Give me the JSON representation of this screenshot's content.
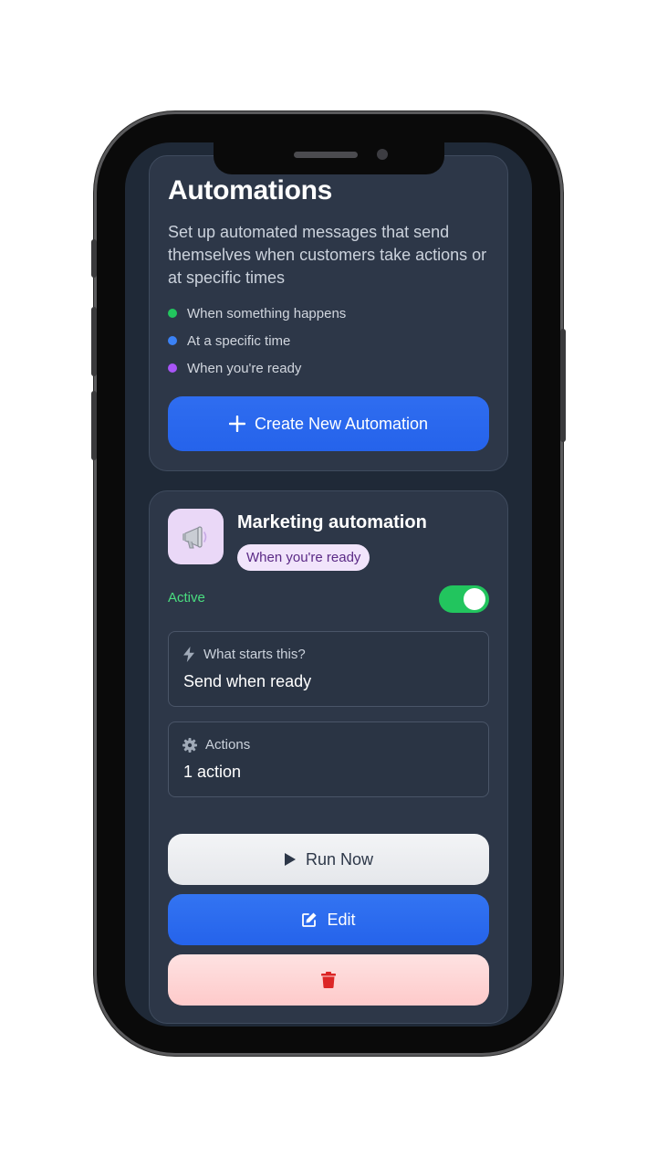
{
  "header": {
    "title": "Automations",
    "description": "Set up automated messages that send themselves when customers take actions or at specific times"
  },
  "triggers": [
    {
      "label": "When something happens",
      "color": "#22c55e"
    },
    {
      "label": "At a specific time",
      "color": "#3b82f6"
    },
    {
      "label": "When you're ready",
      "color": "#a855f7"
    }
  ],
  "create_button": {
    "label": "Create New Automation",
    "icon": "plus-icon"
  },
  "automation": {
    "icon": "megaphone-icon",
    "name": "Marketing automation",
    "trigger_badge": "When you're ready",
    "status": "Active",
    "enabled": true,
    "trigger_box": {
      "icon": "lightning-icon",
      "label": "What starts this?",
      "value": "Send when ready"
    },
    "actions_box": {
      "icon": "gear-icon",
      "label": "Actions",
      "value": "1 action"
    },
    "run_button": {
      "label": "Run Now",
      "icon": "play-icon"
    },
    "edit_button": {
      "label": "Edit",
      "icon": "edit-icon"
    },
    "delete_button": {
      "icon": "trash-icon"
    }
  },
  "colors": {
    "accent": "#2563eb",
    "active": "#22c55e",
    "danger": "#dc2626"
  }
}
